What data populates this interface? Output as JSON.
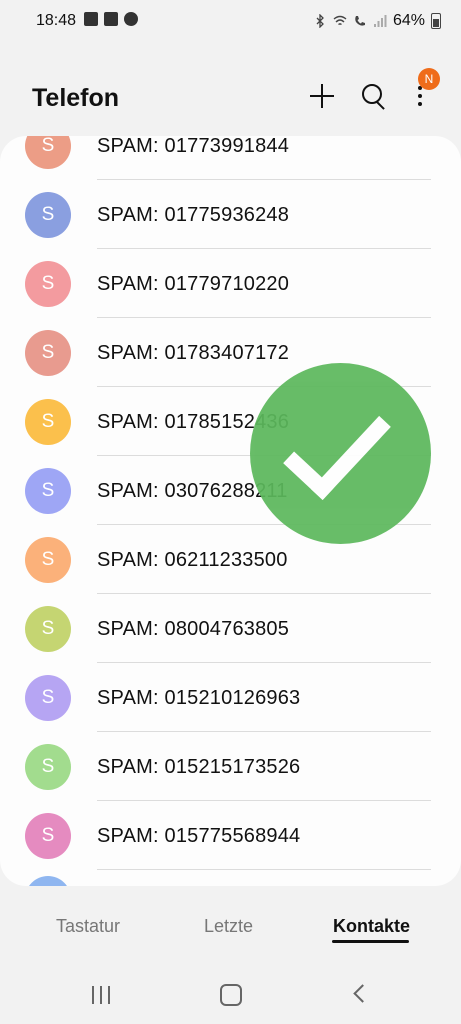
{
  "status_bar": {
    "time": "18:48",
    "battery": "64%",
    "icons_left": [
      "image-icon",
      "app-icon",
      "alert-icon"
    ],
    "icons_right": [
      "bluetooth-icon",
      "wifi-icon",
      "call-icon",
      "signal-icon",
      "battery-icon"
    ]
  },
  "header": {
    "title": "Telefon",
    "add_icon": "plus-icon",
    "search_icon": "search-icon",
    "more_icon": "more-vertical-icon",
    "notification_badge": "N",
    "badge_color": "#ef6c1a"
  },
  "contacts": [
    {
      "initial": "S",
      "name": "SPAM: 01773991844",
      "color": "#ec9d86"
    },
    {
      "initial": "S",
      "name": "SPAM: 01775936248",
      "color": "#8a9fe0"
    },
    {
      "initial": "S",
      "name": "SPAM: 01779710220",
      "color": "#f39b9f"
    },
    {
      "initial": "S",
      "name": "SPAM: 01783407172",
      "color": "#e89b8f"
    },
    {
      "initial": "S",
      "name": "SPAM: 01785152436",
      "color": "#fbc04c"
    },
    {
      "initial": "S",
      "name": "SPAM: 03076288211",
      "color": "#9ea6f5"
    },
    {
      "initial": "S",
      "name": "SPAM: 06211233500",
      "color": "#fbb17a"
    },
    {
      "initial": "S",
      "name": "SPAM: 08004763805",
      "color": "#c5d572"
    },
    {
      "initial": "S",
      "name": "SPAM: 015210126963",
      "color": "#b6a5f3"
    },
    {
      "initial": "S",
      "name": "SPAM: 015215173526",
      "color": "#a2dc8e"
    },
    {
      "initial": "S",
      "name": "SPAM: 015775568944",
      "color": "#e58bc0"
    }
  ],
  "overlay": {
    "icon": "checkmark-icon",
    "color": "#5cb85c"
  },
  "tabs": [
    {
      "label": "Tastatur",
      "active": false
    },
    {
      "label": "Letzte",
      "active": false
    },
    {
      "label": "Kontakte",
      "active": true
    }
  ],
  "nav": {
    "recents_icon": "recents-icon",
    "home_icon": "home-icon",
    "back_icon": "back-icon"
  }
}
